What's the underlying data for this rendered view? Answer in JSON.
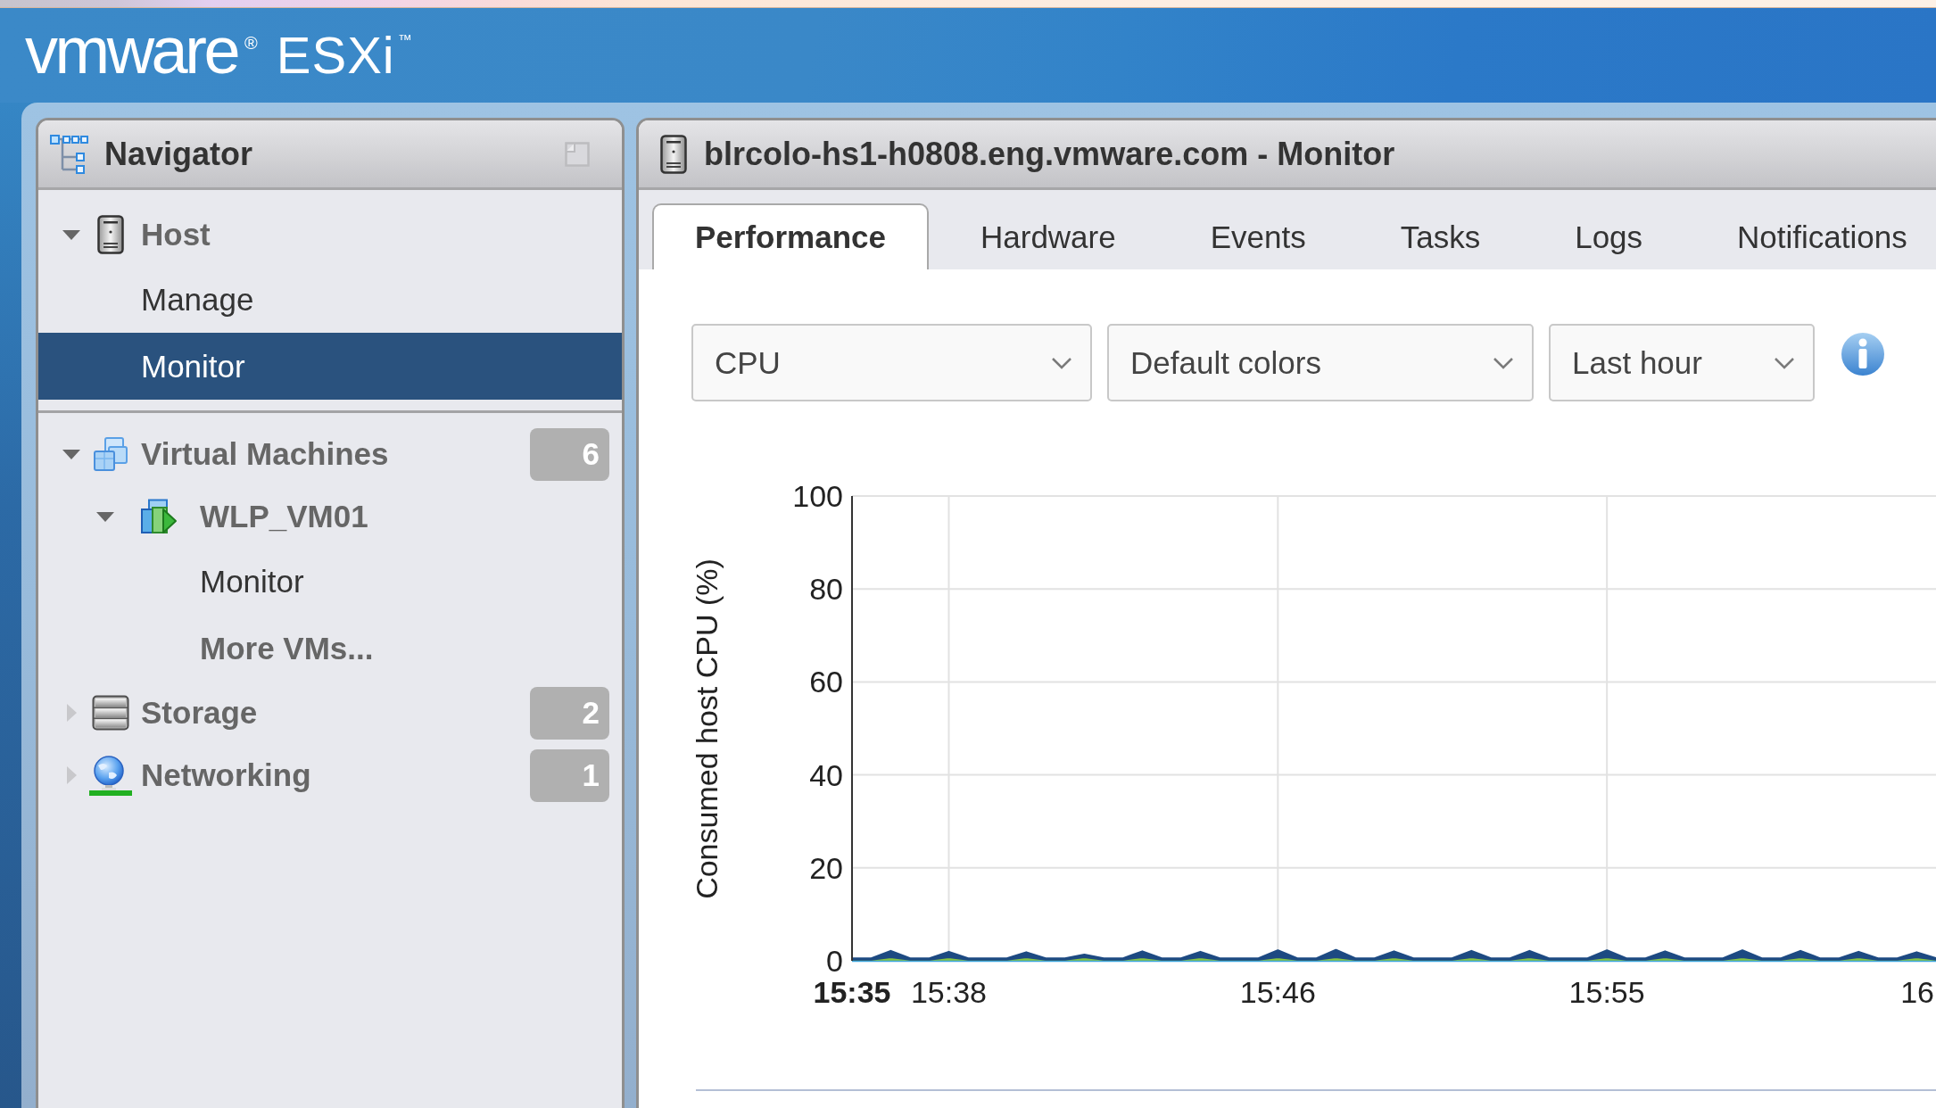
{
  "logo": {
    "brand": "vmware$^{®}$",
    "product": "ESXi$^{™}$"
  },
  "navigator": {
    "title": "Navigator",
    "sections": [
      {
        "items": [
          {
            "label": "Host",
            "kind": "host",
            "expanded": true,
            "selected": false,
            "children": [
              {
                "label": "Manage",
                "kind": "page",
                "selected": false
              },
              {
                "label": "Monitor",
                "kind": "page",
                "selected": true
              }
            ]
          }
        ]
      },
      {
        "items": [
          {
            "label": "Virtual Machines",
            "kind": "vms",
            "expanded": true,
            "selected": false,
            "count": "6",
            "children": [
              {
                "label": "WLP_VM01",
                "kind": "vm",
                "expanded": true,
                "selected": false,
                "children": [
                  {
                    "label": "Monitor",
                    "kind": "page",
                    "selected": false
                  }
                ]
              },
              {
                "label": "More VMs...",
                "kind": "more",
                "selected": false
              }
            ]
          },
          {
            "label": "Storage",
            "kind": "storage",
            "expanded": false,
            "selected": false,
            "count": "2"
          },
          {
            "label": "Networking",
            "kind": "network",
            "expanded": false,
            "selected": false,
            "count": "1"
          }
        ]
      }
    ]
  },
  "panel": {
    "title": "blrcolo-hs1-h0808.eng.vmware.com - Monitor",
    "tabs": [
      {
        "label": "Performance",
        "selected": true
      },
      {
        "label": "Hardware",
        "selected": false
      },
      {
        "label": "Events",
        "selected": false
      },
      {
        "label": "Tasks",
        "selected": false
      },
      {
        "label": "Logs",
        "selected": false
      },
      {
        "label": "Notifications",
        "selected": false
      }
    ],
    "selectors": [
      {
        "value": "CPU"
      },
      {
        "value": "Default colors"
      },
      {
        "value": "Last hour"
      }
    ],
    "chart_data": {
      "type": "area",
      "stacked": true,
      "grid": true,
      "ylabel": "Consumed host CPU (%)",
      "ylim": [
        0,
        100
      ],
      "yticks": [
        0,
        20,
        40,
        60,
        80,
        100
      ],
      "categories": [
        "15:35",
        null,
        null,
        null,
        null,
        "15:38",
        null,
        null,
        null,
        null,
        null,
        null,
        null,
        null,
        null,
        null,
        null,
        null,
        null,
        null,
        null,
        null,
        "15:46",
        null,
        null,
        null,
        null,
        null,
        null,
        null,
        null,
        null,
        null,
        null,
        null,
        null,
        null,
        null,
        null,
        "15:55",
        null,
        null,
        null,
        null,
        null,
        null,
        null,
        null,
        null,
        null,
        null,
        null,
        null,
        null,
        null,
        null,
        "16"
      ],
      "series": [
        {
          "color": "#3ea7de",
          "values": [
            0.3,
            0.3,
            0.3,
            0.3,
            0.3,
            0.3,
            0.3,
            0.3,
            0.3,
            0.3,
            0.3,
            0.3,
            0.3,
            0.3,
            0.3,
            0.3,
            0.3,
            0.3,
            0.3,
            0.3,
            0.3,
            0.3,
            0.3,
            0.3,
            0.3,
            0.3,
            0.3,
            0.3,
            0.3,
            0.3,
            0.3,
            0.3,
            0.3,
            0.3,
            0.3,
            0.3,
            0.3,
            0.3,
            0.3,
            0.3,
            0.3,
            0.3,
            0.3,
            0.3,
            0.3,
            0.3,
            0.3,
            0.3,
            0.3,
            0.3,
            0.3,
            0.3,
            0.3,
            0.3,
            0.3,
            0.3,
            0.3
          ]
        },
        {
          "color": "#86c440",
          "values": [
            0,
            0,
            0.5,
            0,
            0,
            0.5,
            0,
            0,
            0,
            0.5,
            0,
            0,
            0.5,
            0,
            0,
            0.5,
            0,
            0,
            0.5,
            0,
            0,
            0,
            0.5,
            0,
            0,
            0.5,
            0,
            0,
            0.5,
            0,
            0,
            0,
            0.5,
            0,
            0,
            0.5,
            0,
            0,
            0,
            0.5,
            0,
            0,
            0.5,
            0,
            0,
            0,
            0.5,
            0,
            0,
            0.5,
            0,
            0,
            0.5,
            0,
            0,
            0.5,
            0
          ]
        },
        {
          "color": "#1d4a82",
          "values": [
            0.2,
            0.2,
            1.3,
            0.2,
            0.2,
            1.1,
            0.2,
            0.2,
            0.2,
            1.0,
            0.2,
            0.2,
            0.5,
            0.2,
            0.2,
            1.2,
            0.2,
            0.2,
            1.1,
            0.2,
            0.2,
            0.2,
            1.4,
            0.2,
            0.2,
            1.5,
            0.2,
            0.2,
            1.2,
            0.2,
            0.2,
            0.2,
            1.3,
            0.2,
            0.2,
            1.3,
            0.2,
            0.2,
            0.2,
            1.4,
            0.2,
            0.2,
            1.2,
            0.2,
            0.2,
            0.2,
            1.4,
            0.2,
            0.2,
            1.3,
            0.2,
            0.2,
            1.1,
            0.2,
            0.2,
            1.0,
            0.2
          ]
        }
      ]
    }
  }
}
